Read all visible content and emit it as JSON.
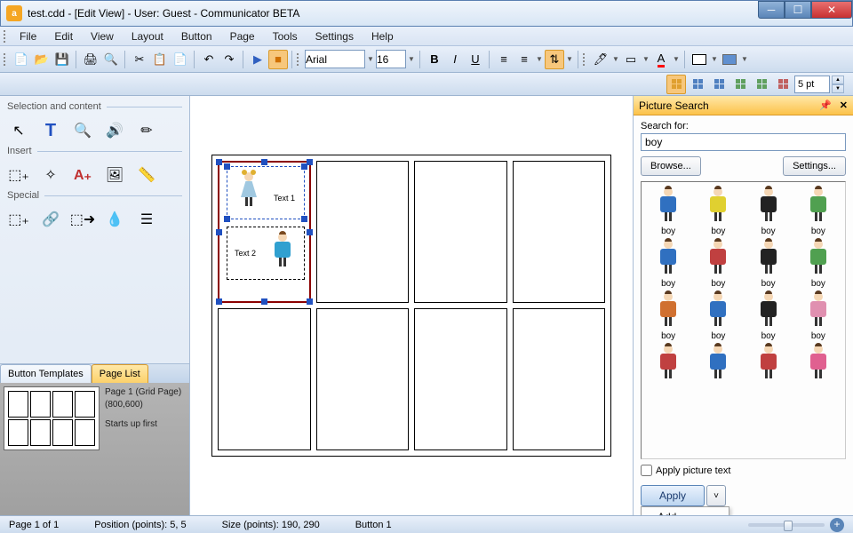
{
  "title": "test.cdd -  [Edit View] - User: Guest - Communicator BETA",
  "menu": [
    "File",
    "Edit",
    "View",
    "Layout",
    "Button",
    "Page",
    "Tools",
    "Settings",
    "Help"
  ],
  "toolbar": {
    "font_name": "Arial",
    "font_size": "16"
  },
  "toolbar2": {
    "pt_value": "5 pt"
  },
  "left": {
    "sec1": "Selection and content",
    "sec2": "Insert",
    "sec3": "Special",
    "tab1": "Button Templates",
    "tab2": "Page List",
    "page_title": "Page 1 (Grid Page)",
    "page_dims": "(800,600)",
    "page_note": "Starts up first"
  },
  "canvas": {
    "text1": "Text 1",
    "text2": "Text 2"
  },
  "picture_search": {
    "title": "Picture Search",
    "search_label": "Search for:",
    "search_value": "boy",
    "browse": "Browse...",
    "settings": "Settings...",
    "apply_text_chk": "Apply picture text",
    "apply": "Apply",
    "dd_add": "Add",
    "results": [
      "boy",
      "boy",
      "boy",
      "boy",
      "boy",
      "boy",
      "boy",
      "boy",
      "boy",
      "boy",
      "boy",
      "boy",
      "",
      "",
      "",
      ""
    ]
  },
  "status": {
    "page": "Page 1 of 1",
    "pos": "Position (points): 5, 5",
    "size": "Size (points): 190, 290",
    "button": "Button 1"
  }
}
